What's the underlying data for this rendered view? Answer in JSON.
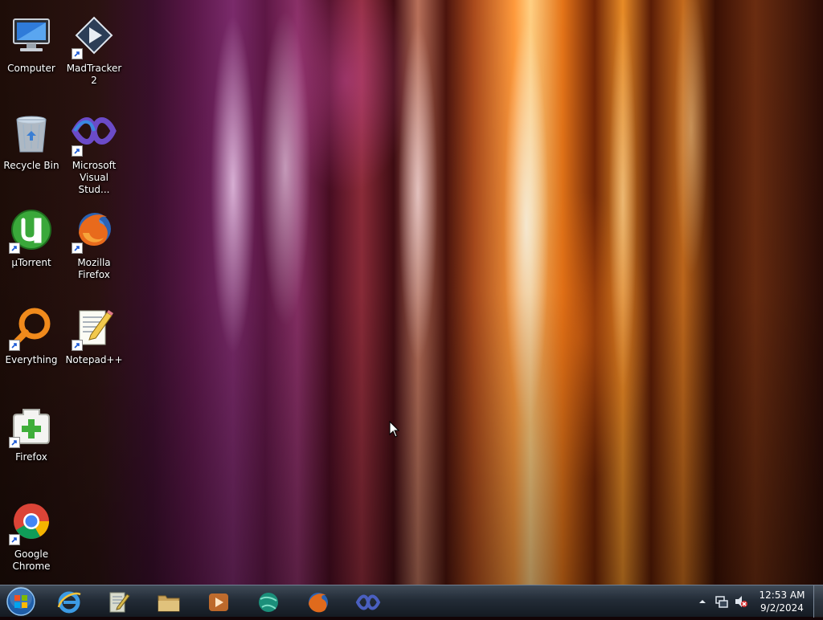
{
  "desktop_icons": [
    {
      "id": "computer",
      "label": "Computer",
      "icon": "computer-icon"
    },
    {
      "id": "recycle-bin",
      "label": "Recycle Bin",
      "icon": "recycle-bin-icon"
    },
    {
      "id": "utorrent",
      "label": "µTorrent",
      "icon": "utorrent-icon"
    },
    {
      "id": "everything",
      "label": "Everything",
      "icon": "everything-search-icon"
    },
    {
      "id": "firefox-portable",
      "label": "Firefox",
      "icon": "portable-app-icon"
    },
    {
      "id": "google-chrome",
      "label": "Google Chrome",
      "icon": "chrome-icon"
    },
    {
      "id": "madtracker",
      "label": "MadTracker 2",
      "icon": "madtracker-icon"
    },
    {
      "id": "visual-studio",
      "label": "Microsoft Visual Stud...",
      "icon": "visual-studio-icon"
    },
    {
      "id": "mozilla-firefox",
      "label": "Mozilla Firefox",
      "icon": "firefox-icon"
    },
    {
      "id": "notepadpp",
      "label": "Notepad++",
      "icon": "notepadpp-icon"
    }
  ],
  "taskbar": {
    "start_icon": "windows-logo-icon",
    "pinned": [
      {
        "name": "Internet Explorer",
        "icon": "internet-explorer-icon"
      },
      {
        "name": "Notepad++",
        "icon": "notepadpp-icon"
      },
      {
        "name": "Windows Explorer",
        "icon": "folder-icon"
      },
      {
        "name": "Windows Media Player",
        "icon": "media-player-icon"
      },
      {
        "name": "Network",
        "icon": "network-globe-icon"
      },
      {
        "name": "Mozilla Firefox",
        "icon": "firefox-icon"
      },
      {
        "name": "Microsoft Visual Studio",
        "icon": "visual-studio-icon"
      }
    ],
    "tray": {
      "icons": [
        "show-hidden-icons-arrow",
        "network-icon",
        "volume-muted-icon"
      ],
      "time": "12:53 AM",
      "date": "9/2/2024"
    }
  },
  "colors": {
    "taskbar_top": "#3f4a57",
    "taskbar_bottom": "#141a22",
    "label_text": "#ffffff"
  }
}
